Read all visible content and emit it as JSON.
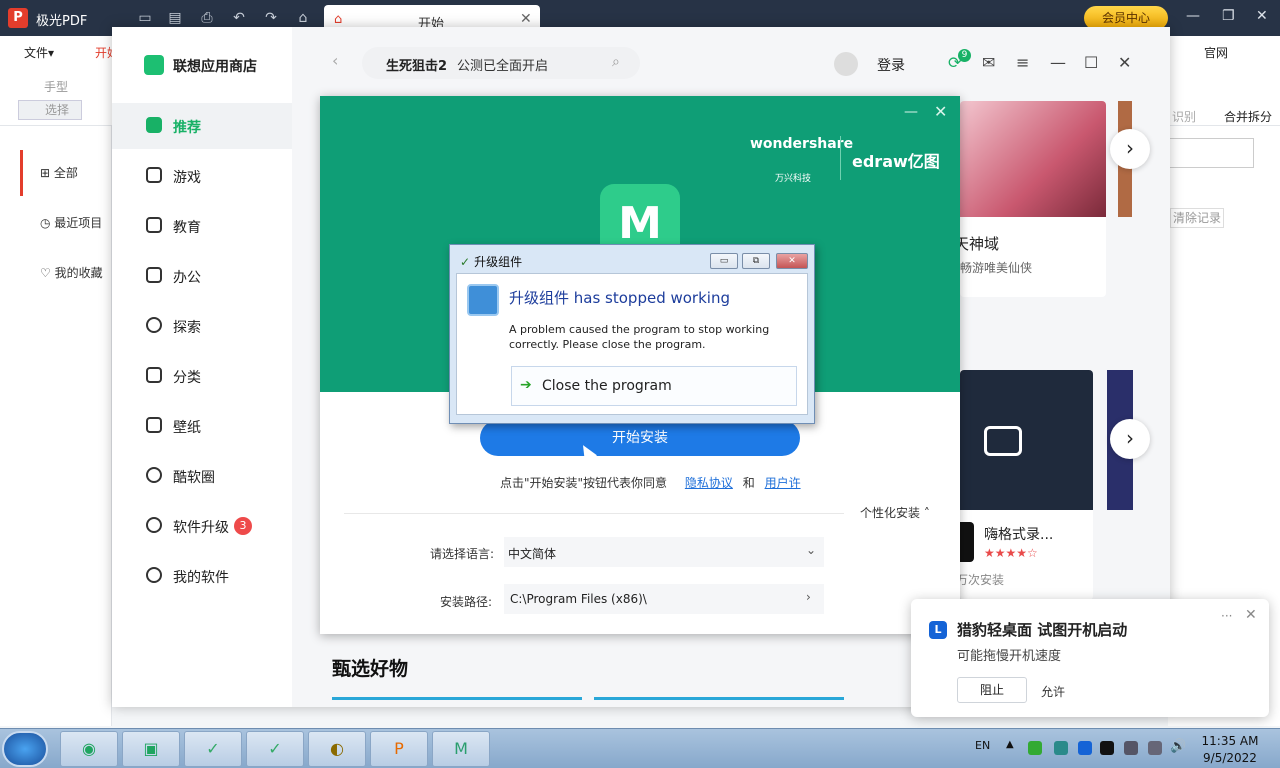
{
  "pdf_app": {
    "title": "极光PDF",
    "tab_label": "开始",
    "vip_label": "会员中心",
    "menu_file": "文件▾",
    "menu_start": "开始",
    "menu_official": "官网",
    "tool_hand": "手型",
    "tool_select": "选择",
    "tool_ocr": "识别",
    "tool_merge": "合并拆分",
    "left_items": [
      "全部",
      "最近项目",
      "我的收藏"
    ],
    "clear_records": "清除记录"
  },
  "store": {
    "name": "联想应用商店",
    "search_bold": "生死狙击2",
    "search_text": "公测已全面开启",
    "login": "登录",
    "badge_count": "9",
    "nav": [
      {
        "label": "推荐",
        "active": true
      },
      {
        "label": "游戏"
      },
      {
        "label": "教育"
      },
      {
        "label": "办公"
      },
      {
        "label": "探索"
      },
      {
        "label": "分类"
      },
      {
        "label": "壁纸"
      },
      {
        "label": "酷软圈"
      },
      {
        "label": "软件升级",
        "badge": "3"
      },
      {
        "label": "我的软件"
      }
    ],
    "game_title": "天神域",
    "game_sub": "畅游唯美仙侠",
    "app_title": "嗨格式录...",
    "app_rating": "★★★★☆",
    "app_installs": "万次安装",
    "section_title": "甄选好物"
  },
  "installer": {
    "brand1": "wondershare",
    "brand1_sub": "万兴科技",
    "brand2": "edraw亿图",
    "install_button": "开始安装",
    "agree_prefix": "点击\"开始安装\"按钮代表你同意",
    "privacy_link": "隐私协议",
    "and": "和",
    "user_link": "用户许",
    "custom_install": "个性化安装 ˄",
    "language_label": "请选择语言:",
    "language_value": "中文简体",
    "path_label": "安装路径:",
    "path_value": "C:\\Program Files (x86)\\"
  },
  "dialog": {
    "title": "升级组件",
    "heading": "升级组件 has stopped working",
    "message": "A problem caused the program to stop working correctly. Please close the program.",
    "action": "Close the program"
  },
  "toast": {
    "title": "猎豹轻桌面 试图开机启动",
    "subtitle": "可能拖慢开机速度",
    "block": "阻止",
    "allow": "允许"
  },
  "taskbar": {
    "lang": "EN",
    "time": "11:35 AM",
    "date": "9/5/2022",
    "apps": [
      "lenovo-security",
      "app-store",
      "installer-1",
      "installer-2",
      "yuanqi",
      "jiguang-pdf",
      "edraw-setup"
    ]
  }
}
